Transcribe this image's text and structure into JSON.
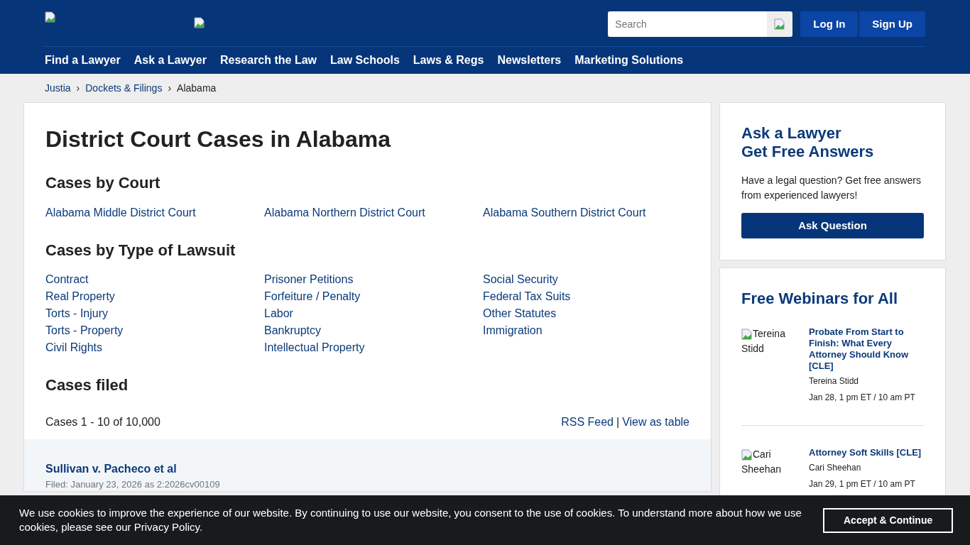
{
  "header": {
    "search": {
      "placeholder": "Search"
    },
    "buttons": [
      "Log In",
      "Sign Up"
    ],
    "nav": [
      "Find a Lawyer",
      "Ask a Lawyer",
      "Research the Law",
      "Law Schools",
      "Laws & Regs",
      "Newsletters",
      "Marketing Solutions"
    ]
  },
  "breadcrumb": {
    "separator": [
      "›",
      "›"
    ],
    "items": [
      {
        "label": "Justia",
        "link": true
      },
      {
        "label": "Dockets & Filings",
        "link": true
      },
      {
        "label": "Alabama",
        "link": false
      }
    ]
  },
  "main": {
    "title": "District Court Cases in Alabama",
    "sections": [
      {
        "heading": "Cases by Court",
        "links": [
          "Alabama Middle District Court",
          "Alabama Northern District Court",
          "Alabama Southern District Court"
        ]
      },
      {
        "heading": "Cases by Type of Lawsuit",
        "links": [
          "Contract",
          "Real Property",
          "Torts - Injury",
          "Torts - Property",
          "Civil Rights",
          "Prisoner Petitions",
          "Forfeiture / Penalty",
          "Labor",
          "Bankruptcy",
          "Intellectual Property",
          "Social Security",
          "Federal Tax Suits",
          "Other Statutes",
          "Immigration"
        ]
      },
      {
        "heading": "Cases filed"
      }
    ],
    "count": "Cases 1 - 10 of 10,000",
    "feed_links": [
      "RSS Feed",
      "View as table"
    ],
    "feed_separator": "|",
    "cases": [
      {
        "title": "Sullivan v. Pacheco et al",
        "filed": "Filed: January 23, 2026 as 2:2026cv00109"
      }
    ]
  },
  "sidebar": {
    "ask": {
      "title": [
        "Ask a Lawyer",
        "Get Free Answers"
      ],
      "text": "Have a legal question? Get free answers from experienced lawyers!",
      "button": "Ask Question"
    },
    "webinars": {
      "title": "Free Webinars for All",
      "items": [
        {
          "alt": "Tereina Stidd",
          "title": "Probate From Start to Finish: What Every Attorney Should Know [CLE]",
          "speaker": "Tereina Stidd",
          "time": "Jan 28, 1 pm ET / 10 am PT"
        },
        {
          "alt": "Cari Sheehan",
          "title": "Attorney Soft Skills [CLE]",
          "speaker": "Cari Sheehan",
          "time": "Jan 29, 1 pm ET / 10 am PT"
        }
      ]
    }
  },
  "cookie": {
    "text_before": "We use cookies to improve the experience of our website. By continuing to use our website, you consent to the use of cookies. To understand more about how we use cookies, please see our",
    "link": "Privacy Policy",
    "text_after": ".",
    "button": "Accept & Continue"
  }
}
